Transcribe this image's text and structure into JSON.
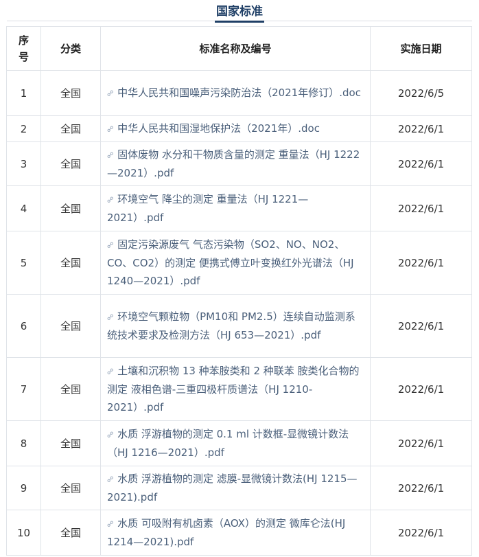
{
  "title": "国家标准",
  "headers": {
    "num": "序号",
    "category": "分类",
    "name": "标准名称及编号",
    "date": "实施日期"
  },
  "rows": [
    {
      "num": "1",
      "category": "全国",
      "name": "中华人民共和国噪声污染防治法（2021年修订）.doc",
      "date": "2022/6/5"
    },
    {
      "num": "2",
      "category": "全国",
      "name": "中华人民共和国湿地保护法（2021年）.doc",
      "date": "2022/6/1"
    },
    {
      "num": "3",
      "category": "全国",
      "name": "固体废物 水分和干物质含量的测定 重量法（HJ 1222—2021）.pdf",
      "date": "2022/6/1"
    },
    {
      "num": "4",
      "category": "全国",
      "name": "环境空气 降尘的测定 重量法（HJ 1221—2021）.pdf",
      "date": "2022/6/1"
    },
    {
      "num": "5",
      "category": "全国",
      "name": "固定污染源废气 气态污染物（SO2、NO、NO2、CO、CO2）的测定 便携式傅立叶变换红外光谱法（HJ 1240—2021）.pdf",
      "date": "2022/6/1"
    },
    {
      "num": "6",
      "category": "全国",
      "name": "环境空气颗粒物（PM10和 PM2.5）连续自动监测系统技术要求及检测方法（HJ 653—2021）.pdf",
      "date": "2022/6/1"
    },
    {
      "num": "7",
      "category": "全国",
      "name": "土壤和沉积物 13 种苯胺类和 2 种联苯 胺类化合物的测定 液相色谱-三重四极杆质谱法（HJ 1210-2021）.pdf",
      "date": "2022/6/1"
    },
    {
      "num": "8",
      "category": "全国",
      "name": "水质 浮游植物的测定 0.1 ml 计数框-显微镜计数法（HJ 1216—2021）.pdf",
      "date": "2022/6/1"
    },
    {
      "num": "9",
      "category": "全国",
      "name": "水质 浮游植物的测定 滤膜-显微镜计数法(HJ 1215—2021).pdf",
      "date": "2022/6/1"
    },
    {
      "num": "10",
      "category": "全国",
      "name": "水质 可吸附有机卤素（AOX）的测定 微库仑法(HJ 1214—2021).pdf",
      "date": "2022/6/1"
    }
  ]
}
